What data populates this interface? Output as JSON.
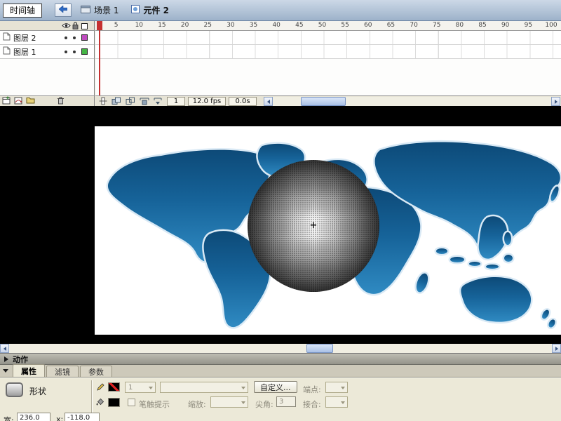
{
  "titlebar": {
    "timeline_button": "时间轴",
    "scene_tab": "场景 1",
    "symbol_tab": "元件 2"
  },
  "timeline": {
    "layers": [
      {
        "name": "图层 2",
        "outline_color": "#c04cc0"
      },
      {
        "name": "图层 1",
        "outline_color": "#44b544"
      }
    ],
    "ruler_numbers": [
      5,
      10,
      15,
      20,
      25,
      30,
      35,
      40,
      45,
      50,
      55,
      60,
      65,
      70,
      75,
      80,
      85,
      90,
      95,
      100
    ],
    "current_frame": "1",
    "frame_rate": "12.0 fps",
    "elapsed_time": "0.0s"
  },
  "stage": {
    "crosshair": "+"
  },
  "actions_panel": {
    "title": "动作"
  },
  "properties_panel": {
    "tabs": [
      "属性",
      "滤镜",
      "参数"
    ],
    "shape_label": "形状",
    "stroke_width_value": "1",
    "custom_button": "自定义...",
    "cap_label": "端点:",
    "stroke_hinting_label": "笔触提示",
    "scale_label": "缩放:",
    "miter_label": "尖角:",
    "miter_value": "3",
    "join_label": "接合:",
    "width_label": "宽:",
    "width_value": "236.0",
    "x_label": "x:",
    "x_value": "-118.0"
  }
}
